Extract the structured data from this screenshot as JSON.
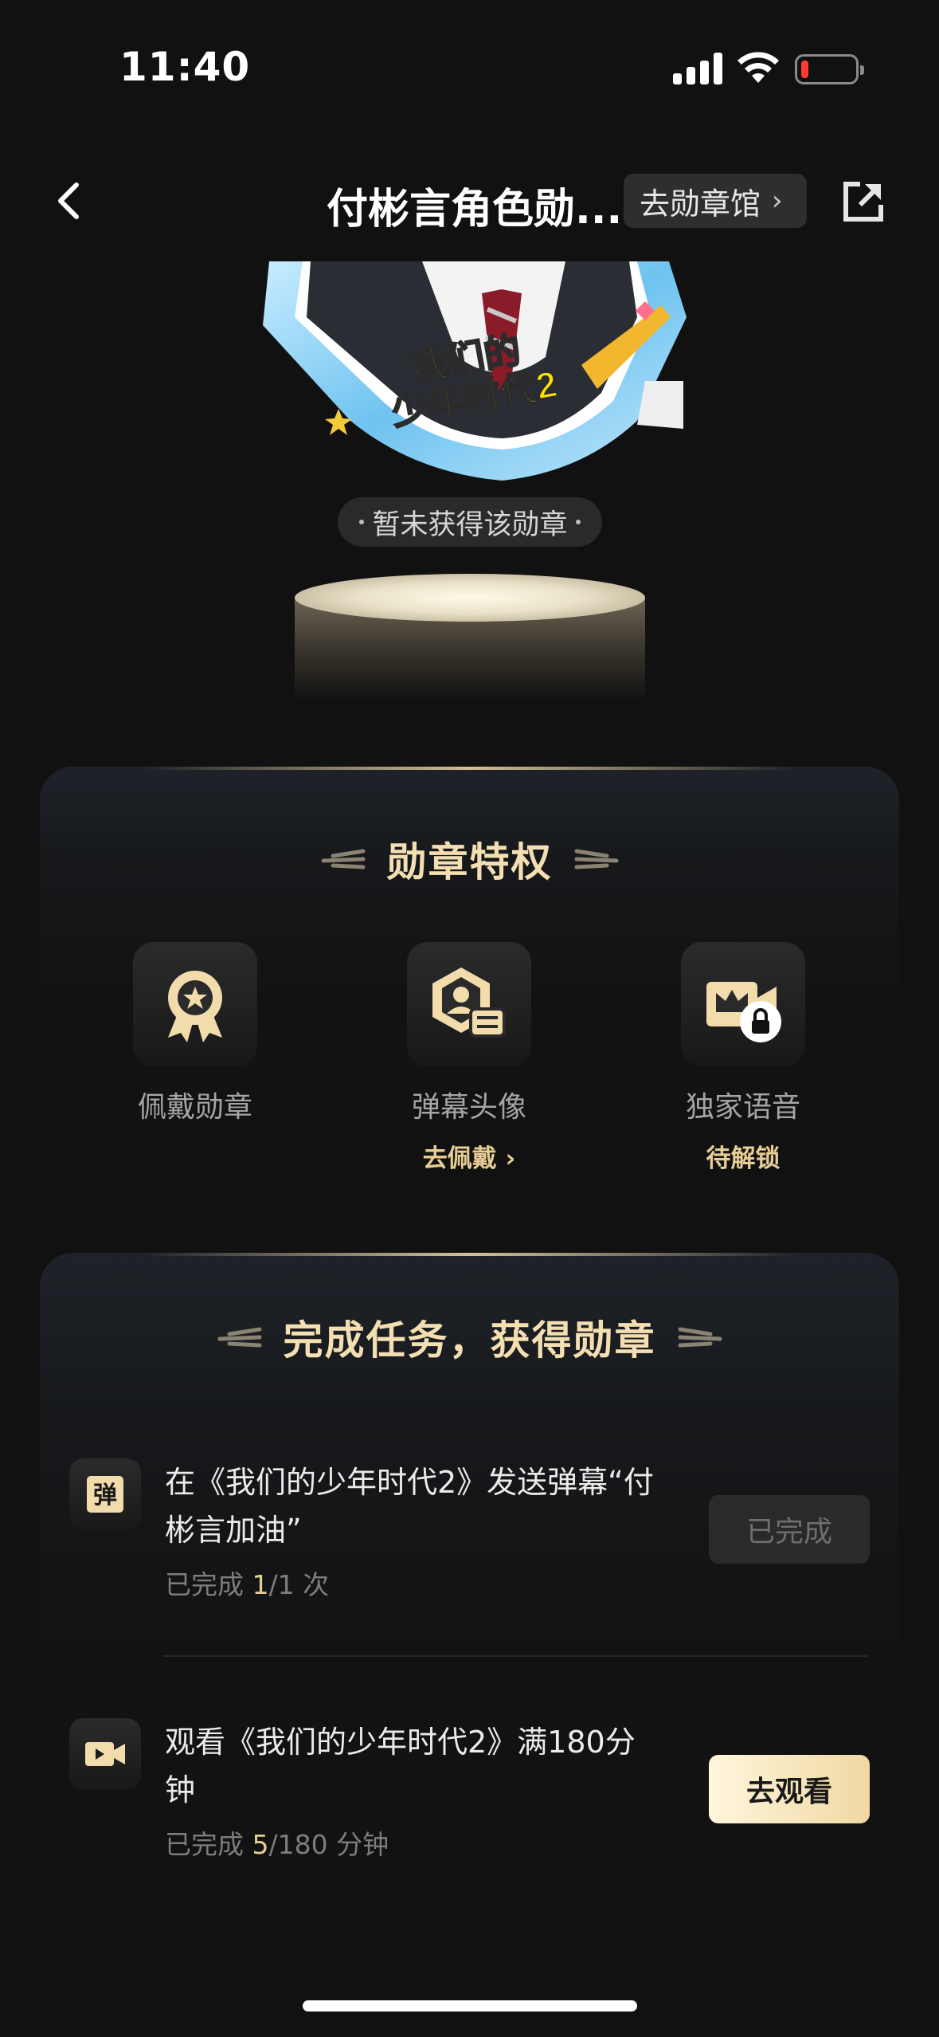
{
  "status_bar": {
    "time": "11:40"
  },
  "nav": {
    "title": "付彬言角色勋...",
    "hall_button": "去勋章馆",
    "hall_chevron": "›"
  },
  "hero": {
    "badge_text_line1": "我们的",
    "badge_text_line2": "少年时代2",
    "status": "暂未获得该勋章"
  },
  "perks": {
    "title": "勋章特权",
    "items": [
      {
        "label": "佩戴勋章",
        "sub": ""
      },
      {
        "label": "弹幕头像",
        "sub": "去佩戴 ›"
      },
      {
        "label": "独家语音",
        "sub": "待解锁"
      }
    ]
  },
  "tasks": {
    "title": "完成任务，获得勋章",
    "items": [
      {
        "icon": "danmaku-icon",
        "icon_char": "弹",
        "text": "在《我们的少年时代2》发送弹幕“付彬言加油”",
        "progress_prefix": "已完成 ",
        "progress_current": "1",
        "progress_rest": "/1 次",
        "button": "已完成"
      },
      {
        "icon": "video-icon",
        "text": "观看《我们的少年时代2》满180分钟",
        "progress_prefix": "已完成 ",
        "progress_current": "5",
        "progress_rest": "/180 分钟",
        "button": "去观看"
      }
    ]
  },
  "colors": {
    "background": "#111111",
    "gold_text": "#f4dfb2",
    "gold_accent": "#e8cd94",
    "button_gold": "#f0d8a2"
  }
}
